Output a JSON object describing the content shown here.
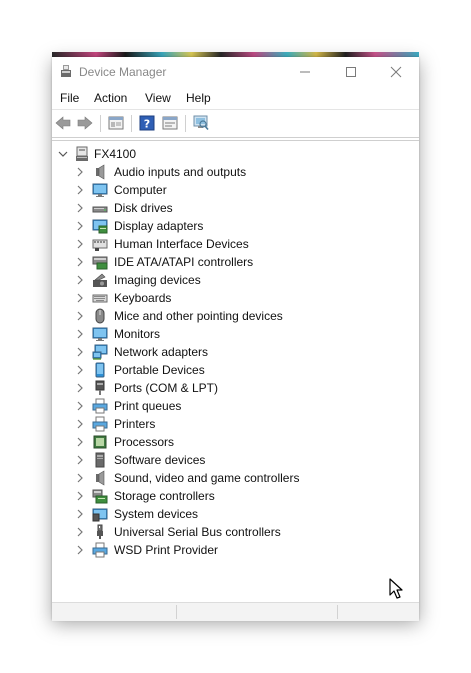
{
  "window": {
    "title": "Device Manager"
  },
  "menu": {
    "items": [
      "File",
      "Action",
      "View",
      "Help"
    ]
  },
  "toolbar": {
    "buttons": [
      "back-arrow-icon",
      "forward-arrow-icon",
      "properties-icon",
      "help-icon",
      "update-driver-icon",
      "scan-hardware-icon"
    ]
  },
  "tree": {
    "root": "FX4100",
    "items": [
      {
        "label": "Audio inputs and outputs",
        "icon": "speaker-icon"
      },
      {
        "label": "Computer",
        "icon": "monitor-icon"
      },
      {
        "label": "Disk drives",
        "icon": "disk-drive-icon"
      },
      {
        "label": "Display adapters",
        "icon": "display-adapter-icon"
      },
      {
        "label": "Human Interface Devices",
        "icon": "hid-icon"
      },
      {
        "label": "IDE ATA/ATAPI controllers",
        "icon": "ide-controller-icon"
      },
      {
        "label": "Imaging devices",
        "icon": "camera-icon"
      },
      {
        "label": "Keyboards",
        "icon": "keyboard-icon"
      },
      {
        "label": "Mice and other pointing devices",
        "icon": "mouse-icon"
      },
      {
        "label": "Monitors",
        "icon": "monitor-icon"
      },
      {
        "label": "Network adapters",
        "icon": "network-icon"
      },
      {
        "label": "Portable Devices",
        "icon": "portable-device-icon"
      },
      {
        "label": "Ports (COM & LPT)",
        "icon": "port-icon"
      },
      {
        "label": "Print queues",
        "icon": "printer-icon"
      },
      {
        "label": "Printers",
        "icon": "printer-icon"
      },
      {
        "label": "Processors",
        "icon": "processor-icon"
      },
      {
        "label": "Software devices",
        "icon": "software-device-icon"
      },
      {
        "label": "Sound, video and game controllers",
        "icon": "speaker-icon"
      },
      {
        "label": "Storage controllers",
        "icon": "storage-controller-icon"
      },
      {
        "label": "System devices",
        "icon": "system-device-icon"
      },
      {
        "label": "Universal Serial Bus controllers",
        "icon": "usb-icon"
      },
      {
        "label": "WSD Print Provider",
        "icon": "printer-icon"
      }
    ]
  }
}
